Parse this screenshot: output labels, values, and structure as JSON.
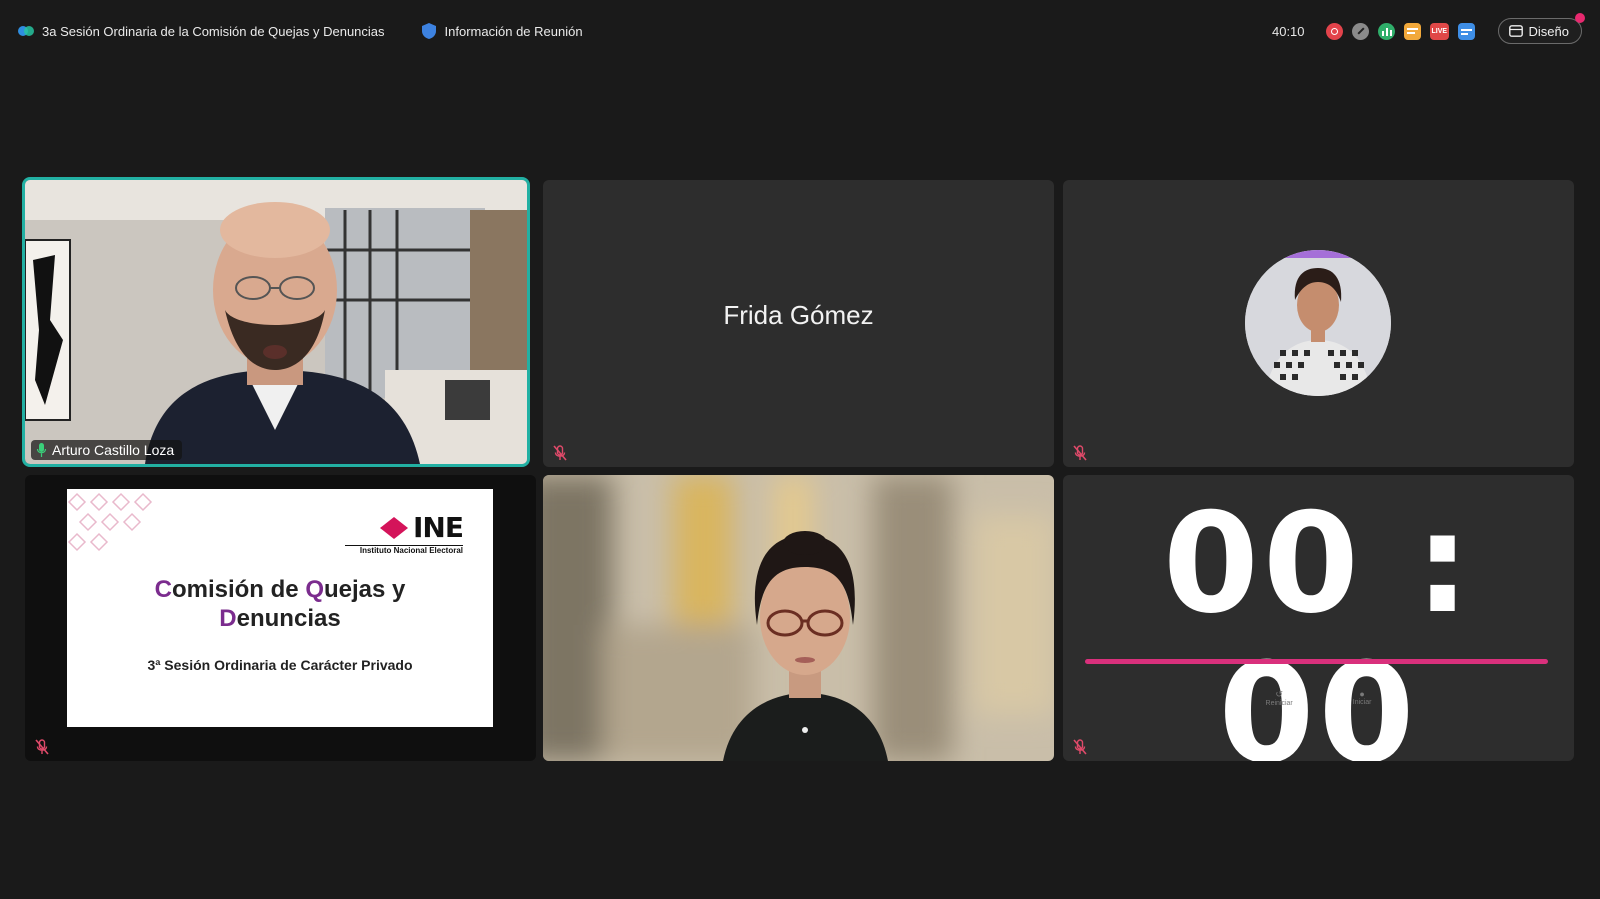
{
  "header": {
    "meeting_title": "3a Sesión Ordinaria de la Comisión de Quejas y Denuncias",
    "info_label": "Información de Reunión",
    "elapsed": "40:10",
    "layout_label": "Diseño"
  },
  "status_icons": [
    "record-icon",
    "pencil-icon",
    "stats-icon",
    "chat-icon",
    "live-icon",
    "share-icon"
  ],
  "participants": {
    "speaker_name": "Arturo Castillo Loza",
    "named_tile": "Frida Gómez"
  },
  "slide": {
    "logo": "INE",
    "logo_sub": "Instituto Nacional Electoral",
    "title_line1_cap1": "C",
    "title_line1_a": "omisión de ",
    "title_line1_cap2": "Q",
    "title_line1_b": "uejas y",
    "title_line2_cap": "D",
    "title_line2_rest": "enuncias",
    "subtitle": "3ª Sesión Ordinaria de Carácter Privado"
  },
  "countdown": {
    "display": "00 : 00",
    "reset_label": "Reiniciar",
    "start_label": "Iniciar"
  },
  "colors": {
    "active_border": "#22b0a3",
    "bar": "#d9307c",
    "brand_purple": "#7b2c8e"
  }
}
